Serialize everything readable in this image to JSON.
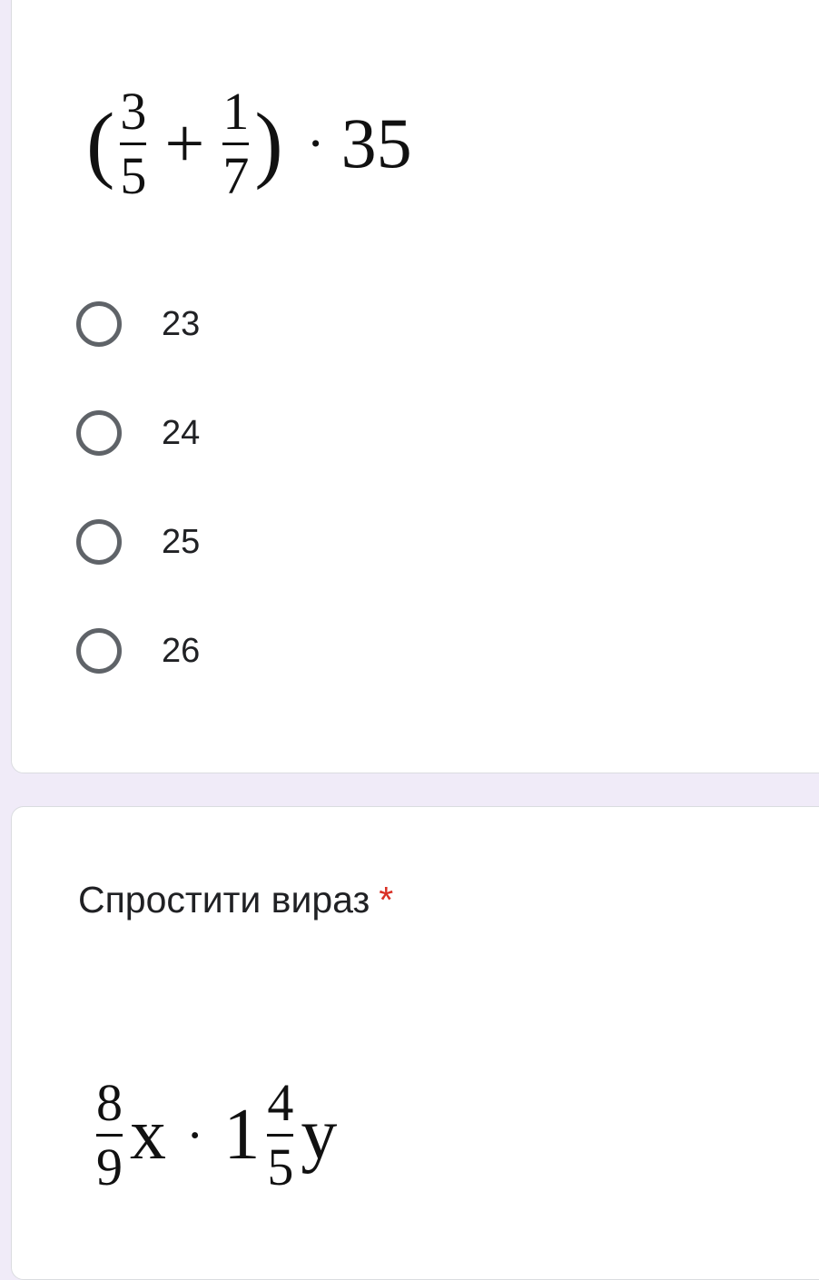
{
  "question1": {
    "expression": {
      "open_paren": "(",
      "frac1": {
        "num": "3",
        "den": "5"
      },
      "plus": "+",
      "frac2": {
        "num": "1",
        "den": "7"
      },
      "close_paren": ")",
      "times": "·",
      "multiplier": "35"
    },
    "options": [
      "23",
      "24",
      "25",
      "26"
    ]
  },
  "question2": {
    "title": "Спростити вираз",
    "required_mark": "*",
    "expression": {
      "frac1": {
        "num": "8",
        "den": "9"
      },
      "var1": "x",
      "times": "·",
      "whole": "1",
      "frac2": {
        "num": "4",
        "den": "5"
      },
      "var2": "y"
    }
  },
  "colors": {
    "page_background": "#f0ebf8",
    "card_background": "#ffffff",
    "required_star": "#d93025",
    "radio_border": "#5f6368"
  }
}
